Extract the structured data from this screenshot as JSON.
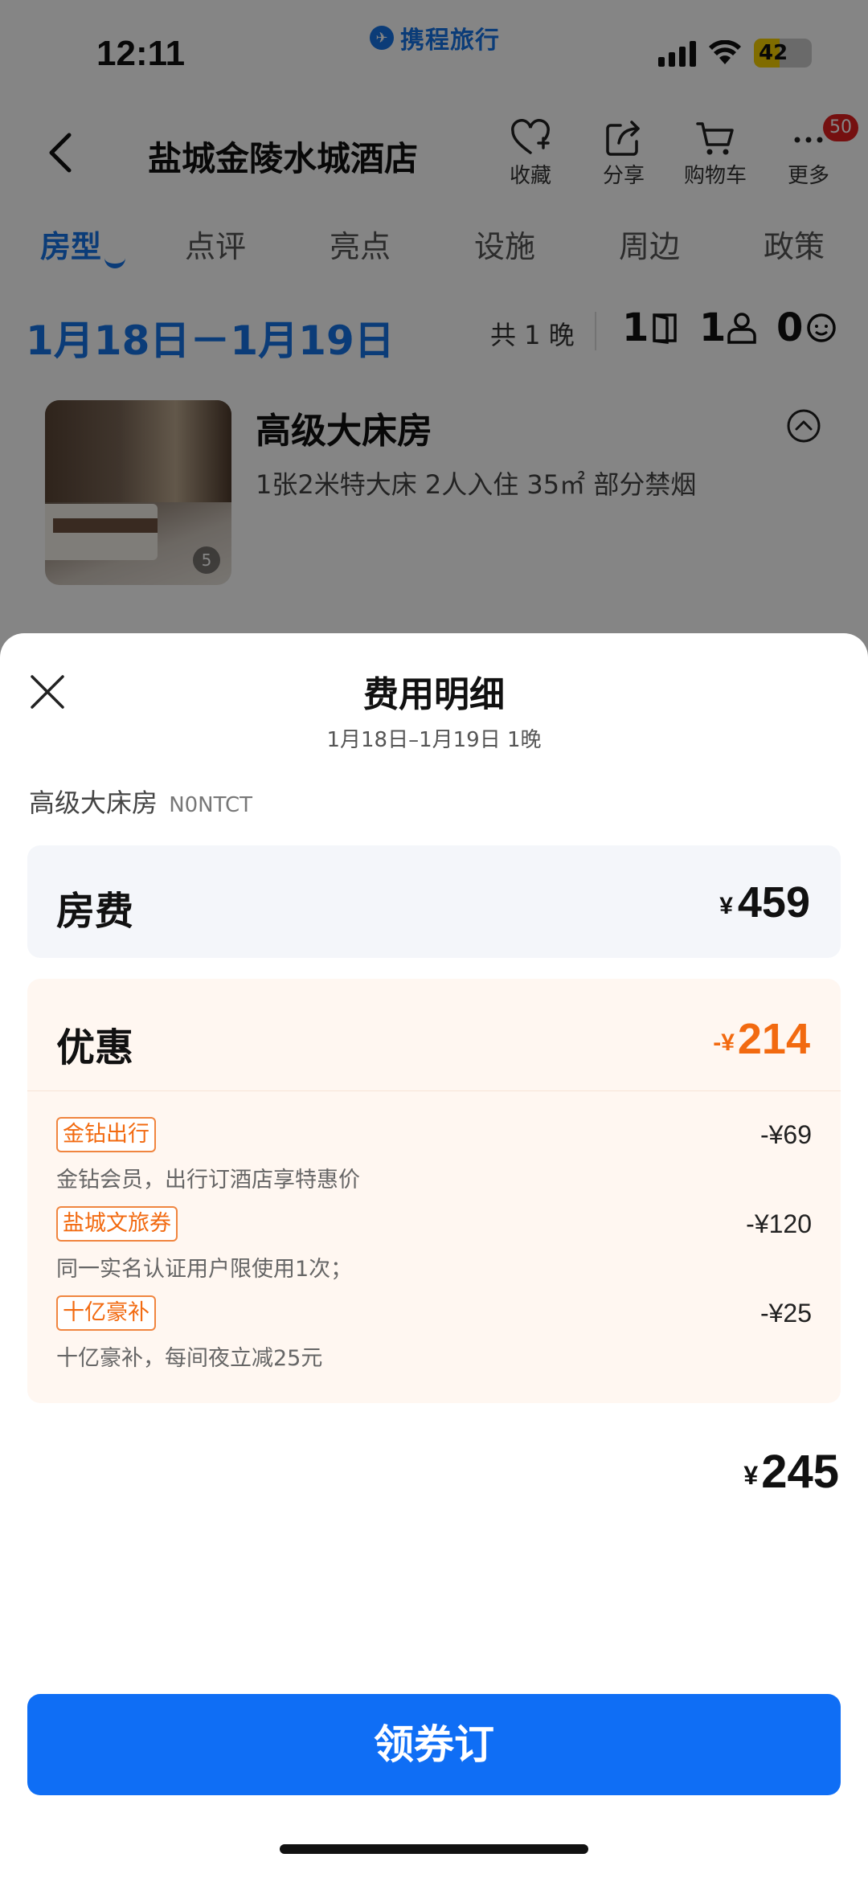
{
  "status_bar": {
    "time": "12:11",
    "brand": "携程旅行",
    "battery": "42"
  },
  "nav": {
    "title": "盐城金陵水城酒店",
    "actions": [
      {
        "label": "收藏",
        "icon": "heart-plus-icon"
      },
      {
        "label": "分享",
        "icon": "share-icon"
      },
      {
        "label": "购物车",
        "icon": "cart-icon"
      },
      {
        "label": "更多",
        "icon": "more-icon",
        "badge": "50"
      }
    ]
  },
  "tabs": [
    {
      "label": "房型",
      "active": true
    },
    {
      "label": "点评"
    },
    {
      "label": "亮点"
    },
    {
      "label": "设施"
    },
    {
      "label": "周边"
    },
    {
      "label": "政策"
    }
  ],
  "date_bar": {
    "range": "1月18日－1月19日",
    "nights": "共 1 晚",
    "rooms": "1",
    "adults": "1",
    "children": "0"
  },
  "room": {
    "name": "高级大床房",
    "desc": "1张2米特大床  2人入住  35㎡  部分禁烟",
    "photo_count": "5"
  },
  "sheet": {
    "title": "费用明细",
    "subtitle": "1月18日–1月19日  1晚",
    "room_name": "高级大床房",
    "room_code": "N0NTCT",
    "fee": {
      "label": "房费",
      "currency": "¥",
      "amount": "459"
    },
    "discount": {
      "label": "优惠",
      "prefix": "-¥",
      "amount": "214",
      "items": [
        {
          "tag": "金钻出行",
          "desc": "金钻会员，出行订酒店享特惠价",
          "amount": "-¥69"
        },
        {
          "tag": "盐城文旅券",
          "desc": "同一实名认证用户限使用1次；",
          "amount": "-¥120"
        },
        {
          "tag": "十亿豪补",
          "desc": "十亿豪补，每间夜立减25元",
          "amount": "-¥25"
        }
      ]
    },
    "total": {
      "currency": "¥",
      "amount": "245"
    },
    "button": "领券订"
  },
  "colors": {
    "brand_blue": "#1673e6",
    "button_blue": "#0f6ef5",
    "discount_orange": "#f26a10"
  }
}
